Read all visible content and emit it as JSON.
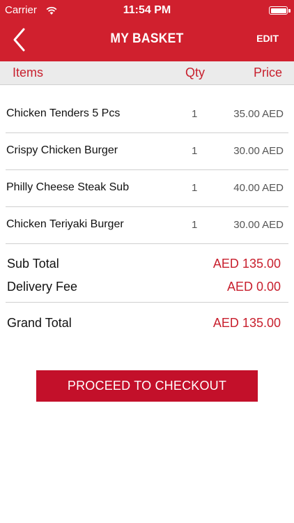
{
  "status_bar": {
    "carrier": "Carrier",
    "time": "11:54 PM",
    "icons": [
      "wifi-icon",
      "battery-icon"
    ]
  },
  "nav": {
    "back_icon": "chevron-left-icon",
    "title": "MY BASKET",
    "edit_label": "EDIT"
  },
  "columns": {
    "items": "Items",
    "qty": "Qty",
    "price": "Price"
  },
  "items": [
    {
      "name": "Chicken Tenders 5 Pcs",
      "qty": "1",
      "price": "35.00 AED"
    },
    {
      "name": "Crispy Chicken Burger",
      "qty": "1",
      "price": "30.00 AED"
    },
    {
      "name": "Philly Cheese Steak Sub",
      "qty": "1",
      "price": "40.00 AED"
    },
    {
      "name": "Chicken Teriyaki Burger",
      "qty": "1",
      "price": "30.00 AED"
    }
  ],
  "summary": {
    "subtotal_label": "Sub Total",
    "subtotal_value": "AED 135.00",
    "delivery_label": "Delivery Fee",
    "delivery_value": "AED 0.00",
    "grand_label": "Grand Total",
    "grand_value": "AED 135.00"
  },
  "checkout_label": "PROCEED TO CHECKOUT",
  "colors": {
    "brand_red": "#d0202e",
    "button_red": "#c3102a",
    "accent_text": "#c8202e"
  }
}
